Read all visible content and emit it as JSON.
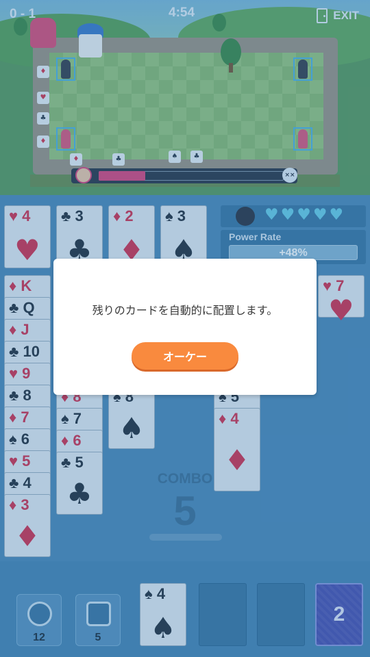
{
  "hud": {
    "score": "0 - 1",
    "timer": "4:54",
    "exit_label": "EXIT"
  },
  "board": {
    "progress_fraction": 0.25
  },
  "player": {
    "hearts": [
      "♥",
      "♥",
      "♥",
      "♥",
      "♥"
    ],
    "power_label": "Power Rate",
    "power_value": "+48%"
  },
  "foundations": [
    {
      "rank": "4",
      "suit": "♥",
      "color": "red"
    },
    {
      "rank": "3",
      "suit": "♣",
      "color": "blk"
    },
    {
      "rank": "2",
      "suit": "♦",
      "color": "red"
    },
    {
      "rank": "3",
      "suit": "♠",
      "color": "blk"
    }
  ],
  "tableau": {
    "col1": [
      {
        "rank": "K",
        "suit": "♦",
        "color": "red"
      },
      {
        "rank": "Q",
        "suit": "♣",
        "color": "blk"
      },
      {
        "rank": "J",
        "suit": "♦",
        "color": "red"
      },
      {
        "rank": "10",
        "suit": "♣",
        "color": "blk"
      },
      {
        "rank": "9",
        "suit": "♥",
        "color": "red"
      },
      {
        "rank": "8",
        "suit": "♣",
        "color": "blk"
      },
      {
        "rank": "7",
        "suit": "♦",
        "color": "red"
      },
      {
        "rank": "6",
        "suit": "♠",
        "color": "blk"
      },
      {
        "rank": "5",
        "suit": "♥",
        "color": "red"
      },
      {
        "rank": "4",
        "suit": "♣",
        "color": "blk"
      },
      {
        "rank": "3",
        "suit": "♦",
        "color": "red"
      }
    ],
    "col2": [
      {
        "rank": "8",
        "suit": "♦",
        "color": "red"
      },
      {
        "rank": "7",
        "suit": "♠",
        "color": "blk"
      },
      {
        "rank": "6",
        "suit": "♦",
        "color": "red"
      },
      {
        "rank": "5",
        "suit": "♣",
        "color": "blk"
      }
    ],
    "col3": [
      {
        "rank": "8",
        "suit": "♠",
        "color": "blk"
      }
    ],
    "col4": [
      {
        "rank": "5",
        "suit": "♠",
        "color": "blk"
      },
      {
        "rank": "4",
        "suit": "♦",
        "color": "red"
      }
    ],
    "col5": [
      {
        "rank": "7",
        "suit": "♥",
        "color": "red"
      }
    ]
  },
  "combo": {
    "label": "COMBO",
    "value": "5"
  },
  "tray": {
    "hint_count": "12",
    "undo_count": "5",
    "waste_card": {
      "rank": "4",
      "suit": "♠",
      "color": "blk"
    },
    "stock_count": "2"
  },
  "dialog": {
    "message": "残りのカードを自動的に配置します。",
    "ok_label": "オーケー"
  },
  "colors": {
    "accent": "#f98a3e",
    "heart_blue": "#6ccfe8",
    "card_red": "#d8304d",
    "board_bg": "#4f8ab8"
  }
}
